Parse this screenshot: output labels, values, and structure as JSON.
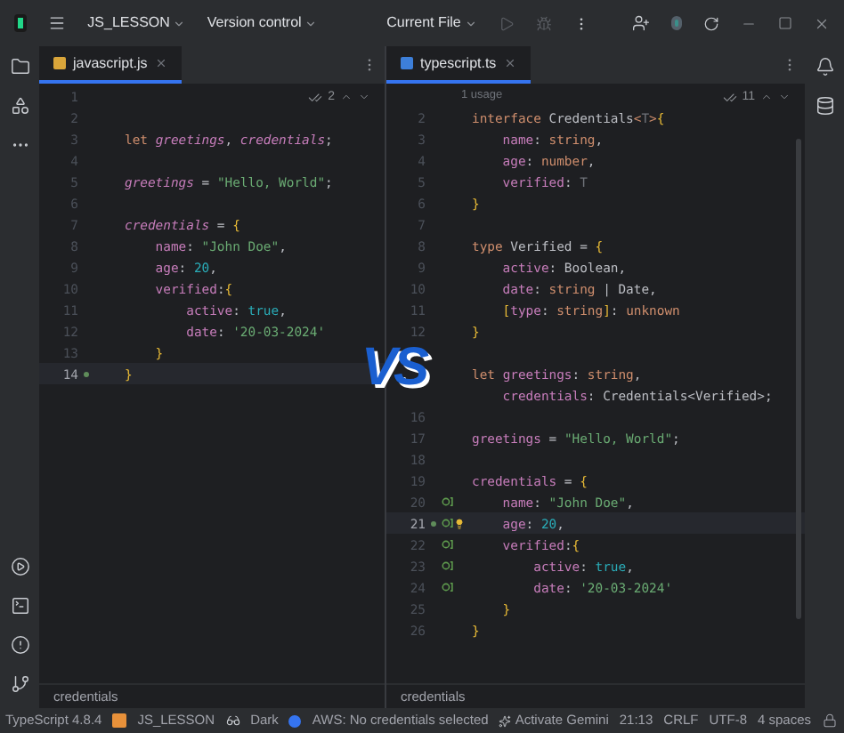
{
  "title_bar": {
    "project": "JS_LESSON",
    "vcs": "Version control",
    "run_config": "Current File"
  },
  "panes": [
    {
      "tab": {
        "label": "javascript.js",
        "kind": "js",
        "selected": true
      },
      "inspection_count": "2",
      "lines": [
        {
          "number": "1",
          "current": false,
          "modified": false,
          "annotated": false,
          "bulb": false
        },
        {
          "number": "2",
          "current": false,
          "modified": false,
          "annotated": false,
          "bulb": false
        },
        {
          "number": "3",
          "current": false,
          "modified": false,
          "annotated": false,
          "bulb": false,
          "tokens": [
            {
              "kind": "keyword",
              "t": "let "
            },
            {
              "kind": "variable",
              "t": "greetings"
            },
            {
              "kind": "plain",
              "t": ", "
            },
            {
              "kind": "variable",
              "t": "credentials"
            },
            {
              "kind": "plain",
              "t": ";"
            }
          ]
        },
        {
          "number": "4",
          "current": false,
          "modified": false,
          "annotated": false,
          "bulb": false
        },
        {
          "number": "5",
          "current": false,
          "modified": false,
          "annotated": false,
          "bulb": false,
          "tokens": [
            {
              "kind": "variable",
              "t": "greetings"
            },
            {
              "kind": "plain",
              "t": " = "
            },
            {
              "kind": "string",
              "t": "\"Hello, World\""
            },
            {
              "kind": "plain",
              "t": ";"
            }
          ]
        },
        {
          "number": "6",
          "current": false,
          "modified": false,
          "annotated": false,
          "bulb": false
        },
        {
          "number": "7",
          "current": false,
          "modified": false,
          "annotated": false,
          "bulb": false,
          "tokens": [
            {
              "kind": "variable",
              "t": "credentials"
            },
            {
              "kind": "plain",
              "t": " = "
            },
            {
              "kind": "brace",
              "t": "{"
            }
          ]
        },
        {
          "number": "8",
          "current": false,
          "modified": false,
          "annotated": false,
          "bulb": false,
          "tokens": [
            {
              "kind": "property",
              "t": "    name"
            },
            {
              "kind": "plain",
              "t": ": "
            },
            {
              "kind": "string",
              "t": "\"John Doe\""
            },
            {
              "kind": "plain",
              "t": ","
            }
          ]
        },
        {
          "number": "9",
          "current": false,
          "modified": false,
          "annotated": false,
          "bulb": false,
          "tokens": [
            {
              "kind": "property",
              "t": "    age"
            },
            {
              "kind": "plain",
              "t": ": "
            },
            {
              "kind": "number",
              "t": "20"
            },
            {
              "kind": "plain",
              "t": ","
            }
          ]
        },
        {
          "number": "10",
          "current": false,
          "modified": false,
          "annotated": false,
          "bulb": false,
          "tokens": [
            {
              "kind": "property",
              "t": "    verified"
            },
            {
              "kind": "plain",
              "t": ":"
            },
            {
              "kind": "brace",
              "t": "{"
            }
          ]
        },
        {
          "number": "11",
          "current": false,
          "modified": false,
          "annotated": false,
          "bulb": false,
          "tokens": [
            {
              "kind": "property",
              "t": "        active"
            },
            {
              "kind": "plain",
              "t": ": "
            },
            {
              "kind": "number",
              "t": "true"
            },
            {
              "kind": "plain",
              "t": ","
            }
          ]
        },
        {
          "number": "12",
          "current": false,
          "modified": false,
          "annotated": false,
          "bulb": false,
          "tokens": [
            {
              "kind": "property",
              "t": "        date"
            },
            {
              "kind": "plain",
              "t": ": "
            },
            {
              "kind": "string",
              "t": "'20-03-2024'"
            }
          ]
        },
        {
          "number": "13",
          "current": false,
          "modified": false,
          "annotated": false,
          "bulb": false,
          "tokens": [
            {
              "kind": "brace",
              "t": "    }"
            }
          ]
        },
        {
          "number": "14",
          "current": true,
          "modified": true,
          "annotated": false,
          "bulb": false,
          "tokens": [
            {
              "kind": "brace",
              "t": "}"
            }
          ]
        }
      ],
      "breadcrumb": "credentials"
    },
    {
      "tab": {
        "label": "typescript.ts",
        "kind": "ts",
        "selected": true
      },
      "inspection_count": "11",
      "usage_hint": "1 usage",
      "lines": [
        {
          "number": "2",
          "current": false,
          "modified": false,
          "annotated": false,
          "bulb": false,
          "tokens": [
            {
              "kind": "keyword",
              "t": "interface "
            },
            {
              "kind": "plain",
              "t": "Credentials"
            },
            {
              "kind": "keyword",
              "t": "<"
            },
            {
              "kind": "dim",
              "t": "T"
            },
            {
              "kind": "keyword",
              "t": ">"
            },
            {
              "kind": "brace",
              "t": "{"
            }
          ]
        },
        {
          "number": "3",
          "current": false,
          "modified": false,
          "annotated": false,
          "bulb": false,
          "tokens": [
            {
              "kind": "property",
              "t": "    name"
            },
            {
              "kind": "plain",
              "t": ": "
            },
            {
              "kind": "keyword",
              "t": "string"
            },
            {
              "kind": "plain",
              "t": ","
            }
          ]
        },
        {
          "number": "4",
          "current": false,
          "modified": false,
          "annotated": false,
          "bulb": false,
          "tokens": [
            {
              "kind": "property",
              "t": "    age"
            },
            {
              "kind": "plain",
              "t": ": "
            },
            {
              "kind": "keyword",
              "t": "number"
            },
            {
              "kind": "plain",
              "t": ","
            }
          ]
        },
        {
          "number": "5",
          "current": false,
          "modified": false,
          "annotated": false,
          "bulb": false,
          "tokens": [
            {
              "kind": "property",
              "t": "    verified"
            },
            {
              "kind": "plain",
              "t": ": "
            },
            {
              "kind": "dim",
              "t": "T"
            }
          ]
        },
        {
          "number": "6",
          "current": false,
          "modified": false,
          "annotated": false,
          "bulb": false,
          "tokens": [
            {
              "kind": "brace",
              "t": "}"
            }
          ]
        },
        {
          "number": "7",
          "current": false,
          "modified": false,
          "annotated": false,
          "bulb": false
        },
        {
          "number": "8",
          "current": false,
          "modified": false,
          "annotated": false,
          "bulb": false,
          "tokens": [
            {
              "kind": "keyword",
              "t": "type "
            },
            {
              "kind": "plain",
              "t": "Verified = "
            },
            {
              "kind": "brace",
              "t": "{"
            }
          ]
        },
        {
          "number": "9",
          "current": false,
          "modified": false,
          "annotated": false,
          "bulb": false,
          "tokens": [
            {
              "kind": "property",
              "t": "    active"
            },
            {
              "kind": "plain",
              "t": ": Boolean,"
            }
          ]
        },
        {
          "number": "10",
          "current": false,
          "modified": false,
          "annotated": false,
          "bulb": false,
          "tokens": [
            {
              "kind": "property",
              "t": "    date"
            },
            {
              "kind": "plain",
              "t": ": "
            },
            {
              "kind": "keyword",
              "t": "string"
            },
            {
              "kind": "plain",
              "t": " | Date,"
            }
          ]
        },
        {
          "number": "11",
          "current": false,
          "modified": false,
          "annotated": false,
          "bulb": false,
          "tokens": [
            {
              "kind": "brace",
              "t": "    ["
            },
            {
              "kind": "property",
              "t": "type"
            },
            {
              "kind": "plain",
              "t": ": "
            },
            {
              "kind": "keyword",
              "t": "string"
            },
            {
              "kind": "brace",
              "t": "]"
            },
            {
              "kind": "plain",
              "t": ": "
            },
            {
              "kind": "keyword",
              "t": "unknown"
            }
          ]
        },
        {
          "number": "12",
          "current": false,
          "modified": false,
          "annotated": false,
          "bulb": false,
          "tokens": [
            {
              "kind": "brace",
              "t": "}"
            }
          ]
        },
        {
          "current": false,
          "modified": false,
          "annotated": false,
          "bulb": false
        },
        {
          "current": false,
          "modified": false,
          "annotated": false,
          "bulb": false,
          "tokens": [
            {
              "kind": "keyword",
              "t": "let "
            },
            {
              "kind": "property",
              "t": "greetings"
            },
            {
              "kind": "plain",
              "t": ": "
            },
            {
              "kind": "keyword",
              "t": "string"
            },
            {
              "kind": "plain",
              "t": ","
            }
          ]
        },
        {
          "current": false,
          "modified": false,
          "annotated": false,
          "bulb": false,
          "tokens": [
            {
              "kind": "property",
              "t": "    credentials"
            },
            {
              "kind": "plain",
              "t": ": Credentials<Verified>;"
            }
          ]
        },
        {
          "number": "16",
          "current": false,
          "modified": false,
          "annotated": false,
          "bulb": false
        },
        {
          "number": "17",
          "current": false,
          "modified": false,
          "annotated": false,
          "bulb": false,
          "tokens": [
            {
              "kind": "property",
              "t": "greetings"
            },
            {
              "kind": "plain",
              "t": " = "
            },
            {
              "kind": "string",
              "t": "\"Hello, World\""
            },
            {
              "kind": "plain",
              "t": ";"
            }
          ]
        },
        {
          "number": "18",
          "current": false,
          "modified": false,
          "annotated": false,
          "bulb": false
        },
        {
          "number": "19",
          "current": false,
          "modified": false,
          "annotated": false,
          "bulb": false,
          "tokens": [
            {
              "kind": "property",
              "t": "credentials"
            },
            {
              "kind": "plain",
              "t": " = "
            },
            {
              "kind": "brace",
              "t": "{"
            }
          ]
        },
        {
          "number": "20",
          "current": false,
          "modified": false,
          "annotated": true,
          "bulb": false,
          "tokens": [
            {
              "kind": "property",
              "t": "    name"
            },
            {
              "kind": "plain",
              "t": ": "
            },
            {
              "kind": "string",
              "t": "\"John Doe\""
            },
            {
              "kind": "plain",
              "t": ","
            }
          ]
        },
        {
          "number": "21",
          "current": true,
          "modified": true,
          "annotated": true,
          "bulb": true,
          "tokens": [
            {
              "kind": "property",
              "t": "    age"
            },
            {
              "kind": "plain",
              "t": ": "
            },
            {
              "kind": "number",
              "t": "20"
            },
            {
              "kind": "plain",
              "t": ","
            }
          ]
        },
        {
          "number": "22",
          "current": false,
          "modified": false,
          "annotated": true,
          "bulb": false,
          "tokens": [
            {
              "kind": "property",
              "t": "    verified"
            },
            {
              "kind": "plain",
              "t": ":"
            },
            {
              "kind": "brace",
              "t": "{"
            }
          ]
        },
        {
          "number": "23",
          "current": false,
          "modified": false,
          "annotated": true,
          "bulb": false,
          "tokens": [
            {
              "kind": "property",
              "t": "        active"
            },
            {
              "kind": "plain",
              "t": ": "
            },
            {
              "kind": "number",
              "t": "true"
            },
            {
              "kind": "plain",
              "t": ","
            }
          ]
        },
        {
          "number": "24",
          "current": false,
          "modified": false,
          "annotated": true,
          "bulb": false,
          "tokens": [
            {
              "kind": "property",
              "t": "        date"
            },
            {
              "kind": "plain",
              "t": ": "
            },
            {
              "kind": "string",
              "t": "'20-03-2024'"
            }
          ]
        },
        {
          "number": "25",
          "current": false,
          "modified": false,
          "annotated": false,
          "bulb": false,
          "tokens": [
            {
              "kind": "brace",
              "t": "    }"
            }
          ]
        },
        {
          "number": "26",
          "current": false,
          "modified": false,
          "annotated": false,
          "bulb": false,
          "tokens": [
            {
              "kind": "brace",
              "t": "}"
            }
          ]
        }
      ],
      "breadcrumb": "credentials"
    }
  ],
  "vs_badge": "VS",
  "status_bar": {
    "language": "TypeScript 4.8.4",
    "project": "JS_LESSON",
    "theme": "Dark",
    "aws": "AWS: No credentials selected",
    "gemini": "Activate Gemini",
    "position": "21:13",
    "line_ending": "CRLF",
    "encoding": "UTF-8",
    "indent": "4 spaces"
  }
}
